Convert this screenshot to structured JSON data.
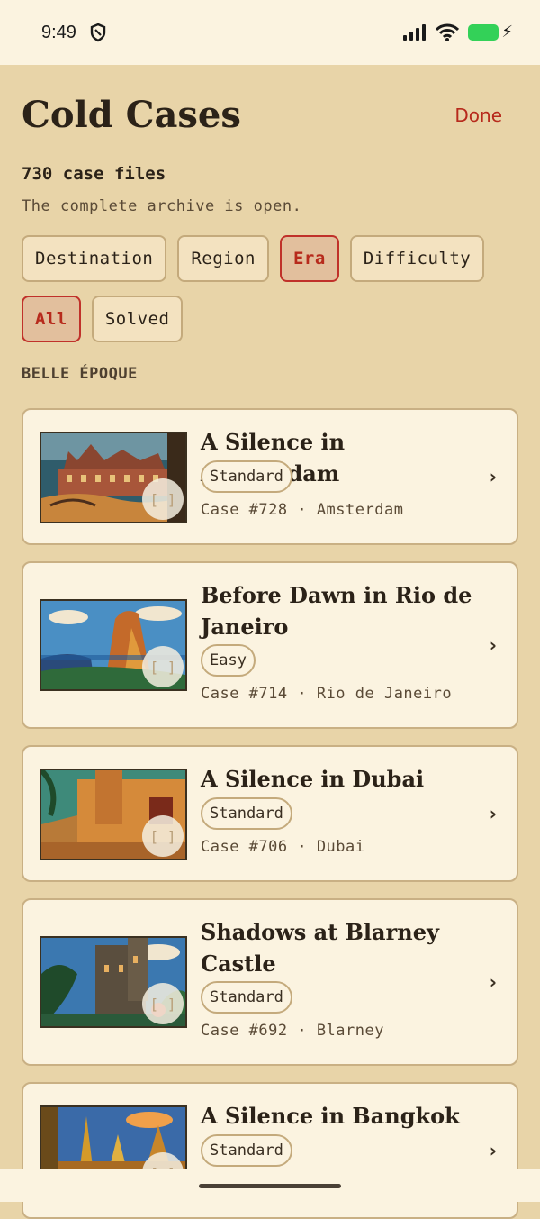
{
  "status": {
    "time": "9:49"
  },
  "header": {
    "title": "Cold Cases",
    "done_label": "Done"
  },
  "summary": {
    "count": "730 case files",
    "subtitle": "The complete archive is open."
  },
  "sort_chips": [
    {
      "label": "Destination",
      "active": false
    },
    {
      "label": "Region",
      "active": false
    },
    {
      "label": "Era",
      "active": true
    },
    {
      "label": "Difficulty",
      "active": false
    }
  ],
  "filter_chips": [
    {
      "label": "All",
      "active": true
    },
    {
      "label": "Solved",
      "active": false
    }
  ],
  "section": {
    "label": "BELLE ÉPOQUE"
  },
  "play_badge": "[ ]",
  "cases": [
    {
      "title": "A Silence in Amsterdam",
      "difficulty": "Standard",
      "meta": "Case #728 · Amsterdam"
    },
    {
      "title": "Before Dawn in Rio de Janeiro",
      "difficulty": "Easy",
      "meta": "Case #714 · Rio de Janeiro"
    },
    {
      "title": "A Silence in Dubai",
      "difficulty": "Standard",
      "meta": "Case #706 · Dubai"
    },
    {
      "title": "Shadows at Blarney Castle",
      "difficulty": "Standard",
      "meta": "Case #692 · Blarney"
    },
    {
      "title": "A Silence in Bangkok",
      "difficulty": "Standard",
      "meta": ""
    }
  ],
  "colors": {
    "accent": "#b72a1c",
    "background": "#e8d4a8",
    "card": "#fbf3e0"
  }
}
